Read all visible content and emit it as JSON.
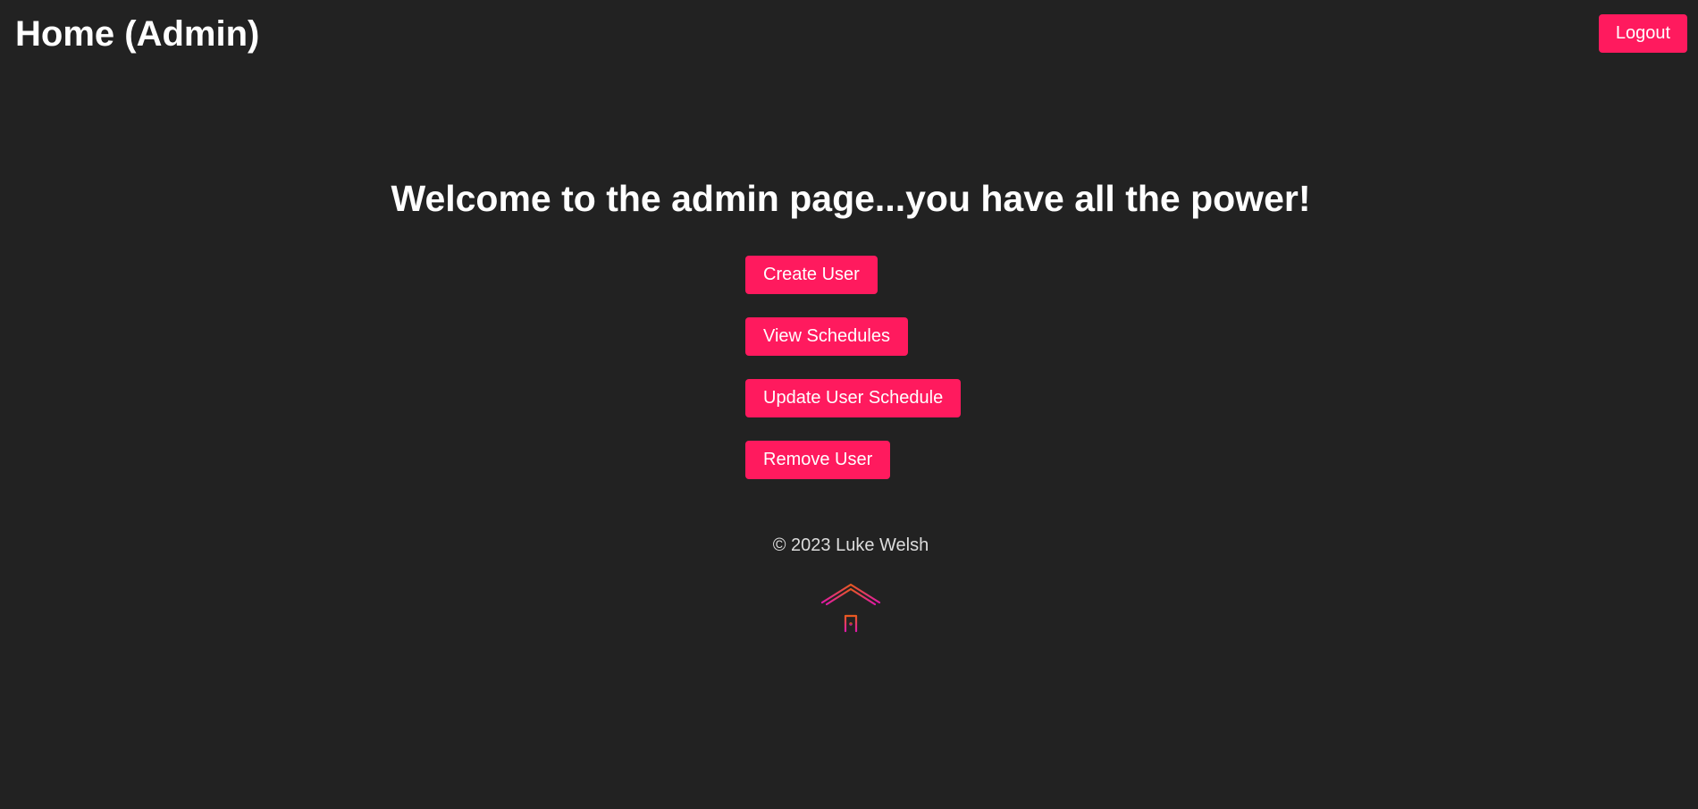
{
  "header": {
    "title": "Home (Admin)",
    "logout_label": "Logout"
  },
  "main": {
    "welcome": "Welcome to the admin page...you have all the power!",
    "actions": [
      {
        "label": "Create User"
      },
      {
        "label": "View Schedules"
      },
      {
        "label": "Update User Schedule"
      },
      {
        "label": "Remove User"
      }
    ]
  },
  "footer": {
    "copyright": "© 2023 Luke Welsh",
    "logo_icon": "house-icon"
  },
  "colors": {
    "background": "#222222",
    "accent": "#ff1a5e",
    "logo_gradient_top": "#e85a1f",
    "logo_gradient_bottom": "#e01aa8"
  }
}
